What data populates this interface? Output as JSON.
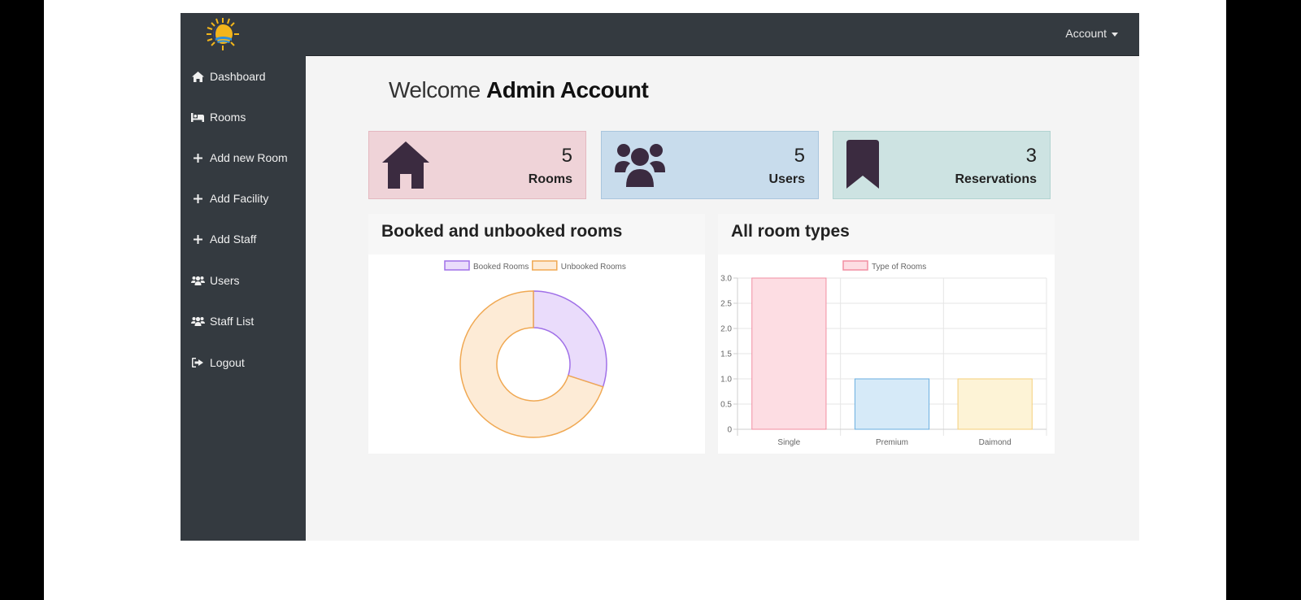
{
  "header": {
    "account_label": "Account"
  },
  "sidebar": {
    "items": [
      {
        "label": "Dashboard",
        "icon": "home-icon"
      },
      {
        "label": "Rooms",
        "icon": "bed-icon"
      },
      {
        "label": "Add new Room",
        "icon": "plus-icon"
      },
      {
        "label": "Add Facility",
        "icon": "plus-icon"
      },
      {
        "label": "Add Staff",
        "icon": "plus-icon"
      },
      {
        "label": "Users",
        "icon": "users-icon"
      },
      {
        "label": "Staff List",
        "icon": "users-icon"
      },
      {
        "label": "Logout",
        "icon": "sign-out-icon"
      }
    ]
  },
  "main": {
    "welcome_prefix": "Welcome",
    "welcome_name": "Admin Account",
    "cards": [
      {
        "value": "5",
        "label": "Rooms",
        "icon": "home-icon",
        "bg": "#efd3d8",
        "border": "#e4b8c0"
      },
      {
        "value": "5",
        "label": "Users",
        "icon": "users-icon",
        "bg": "#c8dcec",
        "border": "#a9c6de"
      },
      {
        "value": "3",
        "label": "Reservations",
        "icon": "bookmark-icon",
        "bg": "#cde3e2",
        "border": "#b1d3d1"
      }
    ],
    "panel_left_title": "Booked and unbooked rooms",
    "panel_right_title": "All room types"
  },
  "colors": {
    "topbar": "#343a40",
    "icon_dark": "#3b2b40"
  },
  "chart_data": [
    {
      "type": "pie",
      "title": "",
      "categories": [
        "Booked Rooms",
        "Unbooked Rooms"
      ],
      "values": [
        3,
        7
      ],
      "colors": {
        "fill": [
          "#eadcfb",
          "#fdebd6"
        ],
        "stroke": [
          "#a070e8",
          "#f0a852"
        ]
      },
      "legend": "top",
      "donut": true
    },
    {
      "type": "bar",
      "title": "",
      "categories": [
        "Single",
        "Premium",
        "Daimond"
      ],
      "series": [
        {
          "name": "Type of Rooms",
          "values": [
            3,
            1,
            1
          ]
        }
      ],
      "ylim": [
        0,
        3.0
      ],
      "yticks": [
        0,
        0.5,
        1.0,
        1.5,
        2.0,
        2.5,
        3.0
      ],
      "ytick_labels": [
        "0",
        "0.5",
        "1.0",
        "1.5",
        "2.0",
        "2.5",
        "3.0"
      ],
      "grid": true,
      "legend": "top",
      "colors": {
        "fill": [
          "#fddde3",
          "#d6eaf8",
          "#fdf3d6"
        ],
        "stroke": [
          "#f28ea2",
          "#6aaee0",
          "#f5cf7a"
        ]
      }
    }
  ]
}
